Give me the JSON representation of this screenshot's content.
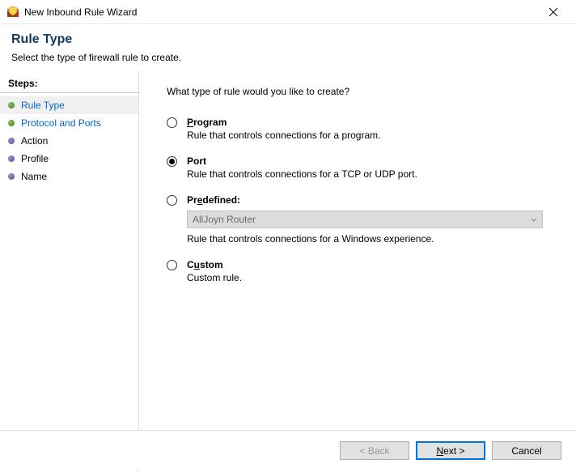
{
  "window": {
    "title": "New Inbound Rule Wizard"
  },
  "header": {
    "title": "Rule Type",
    "subtitle": "Select the type of firewall rule to create."
  },
  "sidebar": {
    "label": "Steps:",
    "steps": [
      {
        "label": "Rule Type"
      },
      {
        "label": "Protocol and Ports"
      },
      {
        "label": "Action"
      },
      {
        "label": "Profile"
      },
      {
        "label": "Name"
      }
    ]
  },
  "main": {
    "question": "What type of rule would you like to create?",
    "options": {
      "program": {
        "label_pre": "P",
        "label_rest": "rogram",
        "desc": "Rule that controls connections for a program."
      },
      "port": {
        "label_pre": "Po",
        "label_rest": "rt",
        "ul": "r",
        "desc": "Rule that controls connections for a TCP or UDP port."
      },
      "predefined": {
        "label_pre": "Pr",
        "label_ul": "e",
        "label_rest": "defined:",
        "desc": "Rule that controls connections for a Windows experience.",
        "combo_value": "AllJoyn Router"
      },
      "custom": {
        "label_pre": "C",
        "label_ul": "u",
        "label_rest": "stom",
        "desc": "Custom rule."
      }
    },
    "selected": "port"
  },
  "footer": {
    "back": "< Back",
    "next": "Next >",
    "cancel": "Cancel"
  }
}
